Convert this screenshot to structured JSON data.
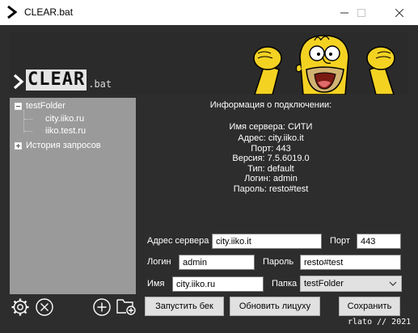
{
  "window": {
    "title": "CLEAR.bat"
  },
  "banner": {
    "logo_main": "CLEAR",
    "logo_ext": ".bat"
  },
  "tree": {
    "folder": "testFolder",
    "items": [
      "city.iiko.ru",
      "iiko.test.ru"
    ],
    "history": "История запросов"
  },
  "info": {
    "title": "Информация о подключении:",
    "server_name": "Имя сервера: СИТИ",
    "address": "Адрес: city.iiko.it",
    "port": "Порт: 443",
    "version": "Версия: 7.5.6019.0",
    "type": "Тип: default",
    "login": "Логин: admin",
    "password": "Пароль: resto#test"
  },
  "form": {
    "address_label": "Адрес сервера",
    "address_value": "city.iiko.it",
    "port_label": "Порт",
    "port_value": "443",
    "login_label": "Логин",
    "login_value": "admin",
    "password_label": "Пароль",
    "password_value": "resto#test",
    "name_label": "Имя",
    "name_value": "city.iiko.ru",
    "folder_label": "Папка",
    "folder_value": "testFolder"
  },
  "buttons": {
    "run_backend": "Запустить бек",
    "refresh_license": "Обновить лицуху",
    "save": "Сохранить"
  },
  "footer": {
    "credit": "rlato // 2021"
  },
  "colors": {
    "background": "#2d2d2d",
    "tree_panel": "#9a9a9a",
    "button_face": "#e1e1e1"
  }
}
